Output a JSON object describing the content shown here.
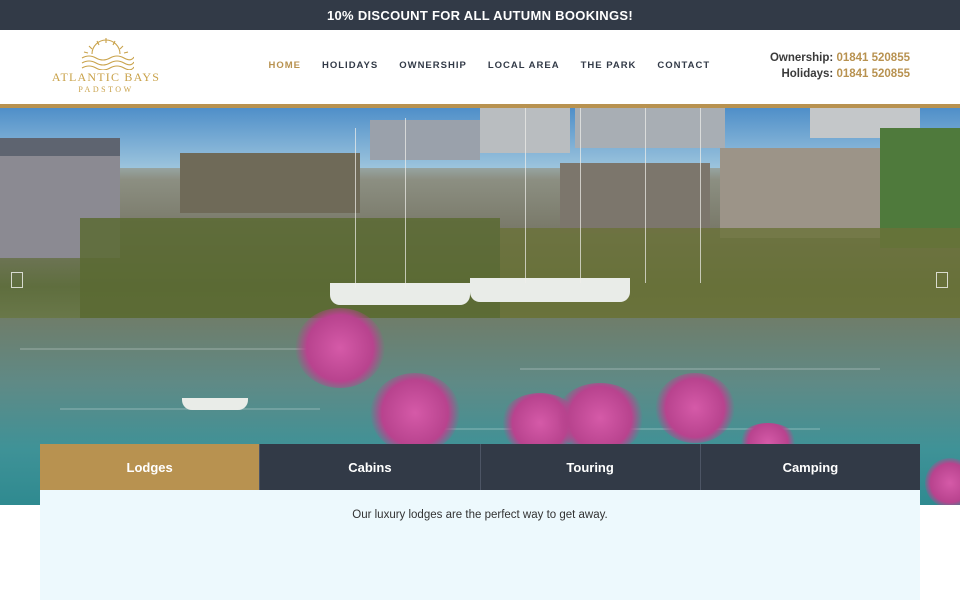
{
  "announcement": "10% DISCOUNT FOR ALL AUTUMN BOOKINGS!",
  "logo": {
    "name": "ATLANTIC BAYS",
    "sub": "PADSTOW",
    "icon": "sunrise-waves-logo-icon"
  },
  "nav": {
    "items": [
      {
        "label": "HOME",
        "active": true
      },
      {
        "label": "HOLIDAYS",
        "active": false
      },
      {
        "label": "OWNERSHIP",
        "active": false
      },
      {
        "label": "LOCAL AREA",
        "active": false
      },
      {
        "label": "THE PARK",
        "active": false
      },
      {
        "label": "CONTACT",
        "active": false
      }
    ]
  },
  "contact": {
    "ownership_label": "Ownership:",
    "ownership_number": "01841 520855",
    "holidays_label": "Holidays:",
    "holidays_number": "01841 520855"
  },
  "hero": {
    "icons": [
      "chevron-left-icon",
      "chevron-right-icon"
    ]
  },
  "tabs": {
    "items": [
      {
        "label": "Lodges",
        "active": true
      },
      {
        "label": "Cabins",
        "active": false
      },
      {
        "label": "Touring",
        "active": false
      },
      {
        "label": "Camping",
        "active": false
      }
    ],
    "panel_text": "Our luxury lodges are the perfect way to get away."
  },
  "colors": {
    "dark": "#323a47",
    "gold": "#b89250",
    "panel": "#edf9fd"
  }
}
